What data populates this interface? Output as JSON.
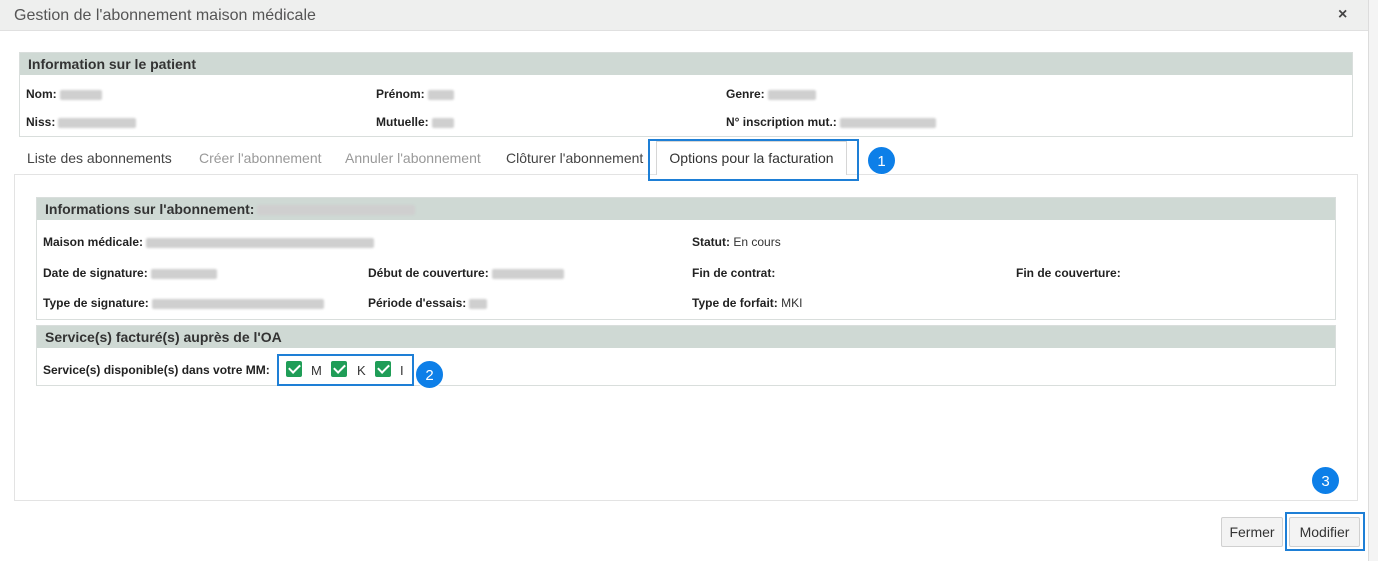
{
  "dialog": {
    "title": "Gestion de l'abonnement maison médicale",
    "close_glyph": "×"
  },
  "patient": {
    "header": "Information sur le patient",
    "nom_label": "Nom:",
    "prenom_label": "Prénom:",
    "genre_label": "Genre:",
    "niss_label": "Niss:",
    "mutuelle_label": "Mutuelle:",
    "inscription_label": "N° inscription mut.:"
  },
  "tabs": [
    {
      "label": "Liste des abonnements",
      "state": "enabled"
    },
    {
      "label": "Créer l'abonnement",
      "state": "disabled"
    },
    {
      "label": "Annuler l'abonnement",
      "state": "disabled"
    },
    {
      "label": "Clôturer l'abonnement",
      "state": "enabled"
    },
    {
      "label": "Options pour la facturation",
      "state": "active"
    }
  ],
  "subscription": {
    "header": "Informations sur l'abonnement:",
    "maison_label": "Maison médicale:",
    "statut_label": "Statut:",
    "statut_value": "En cours",
    "date_signature_label": "Date de signature:",
    "debut_couverture_label": "Début de couverture:",
    "fin_contrat_label": "Fin de contrat:",
    "fin_couverture_label": "Fin de couverture:",
    "type_signature_label": "Type de signature:",
    "periode_essais_label": "Période d'essais:",
    "type_forfait_label": "Type de forfait:",
    "type_forfait_value": "MKI"
  },
  "services": {
    "header": "Service(s) facturé(s) auprès de l'OA",
    "label": "Service(s) disponible(s) dans votre MM:",
    "options": [
      {
        "label": "M",
        "checked": true
      },
      {
        "label": "K",
        "checked": true
      },
      {
        "label": "I",
        "checked": true
      }
    ]
  },
  "annotations": {
    "badge1": "1",
    "badge2": "2",
    "badge3": "3"
  },
  "footer": {
    "close_label": "Fermer",
    "modify_label": "Modifier"
  },
  "colors": {
    "accent": "#0d7fe8",
    "checkbox": "#1f9d57",
    "panel_header": "#cfd9d4"
  }
}
